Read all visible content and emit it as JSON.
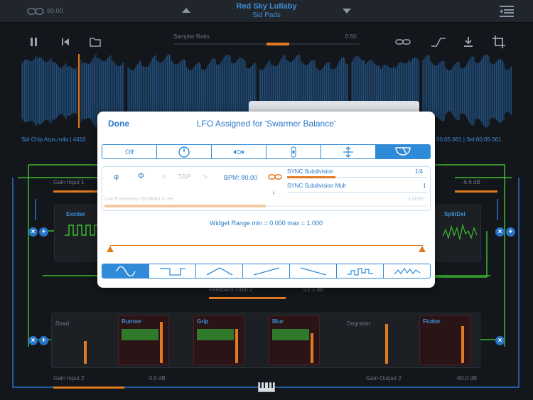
{
  "topbar": {
    "link_value": "60.00",
    "preset_name": "Red Sky Lullaby",
    "preset_bank": "Sid Pads"
  },
  "transport": {
    "sampler_label": "Sampler Ratio",
    "sampler_value": "0.50",
    "sampler_ratio": 0.5
  },
  "waveform": {
    "file_info": "Sid Chip Arps.m4a | 4410",
    "selection_info": "00:05.061 | Sel:00:05.061"
  },
  "rack": {
    "gain_input_1": "Gain Input 1",
    "gain_input_1_value": "-6.6 dB",
    "exciter": "Exciter",
    "splitdel": "SplitDel",
    "feedback_label": "Feedback Orbit 2",
    "feedback_value": "-12.1 dB",
    "dead_label": "Dead",
    "runner": "Runner",
    "grip": "Grip",
    "blur": "Blur",
    "degrader": "Degrader",
    "flutter": "Flutter",
    "gain_input_2": "Gain Input 2",
    "gain_input_2_value": "-3.0 dB",
    "gain_output_2": "Gain Output 2",
    "gain_output_2_value": "-60.0 dB"
  },
  "modal": {
    "done_label": "Done",
    "title": "LFO Assigned for 'Swarmer Balance'",
    "mode_segments": [
      {
        "label": "Off",
        "icon": "off",
        "active": false
      },
      {
        "label": "",
        "icon": "dial-icon",
        "active": false
      },
      {
        "label": "",
        "icon": "horizontal-move-icon",
        "active": false
      },
      {
        "label": "",
        "icon": "vertical-move-icon",
        "active": false
      },
      {
        "label": "",
        "icon": "arrows-vertical-icon",
        "active": false
      },
      {
        "label": "",
        "icon": "gauge-icon",
        "active": true
      }
    ],
    "lfo": {
      "phase_symbol": "φ",
      "invert_symbol": "Φ",
      "prev": "<",
      "tap": "TAP",
      "next": ">",
      "bpm": "BPM: 80.00",
      "sync_subdivision_label": "SYNC Subdivision",
      "sync_subdivision_value": "1/4",
      "sync_subdivision_mult_label": "SYNC Subdivision Mult",
      "sync_subdivision_mult_value": "1",
      "freq_label": "Low Frequency Oscillator in Hz",
      "freq_value": "1.0000",
      "freq_level": 0.5
    },
    "range_label": "Widget Range min = 0.000 max = 1.000",
    "shapes": [
      {
        "icon": "sine-wave-icon",
        "active": true
      },
      {
        "icon": "square-wave-icon",
        "active": false
      },
      {
        "icon": "triangle-wave-icon",
        "active": false
      },
      {
        "icon": "ramp-up-icon",
        "active": false
      },
      {
        "icon": "ramp-down-icon",
        "active": false
      },
      {
        "icon": "random-step-icon",
        "active": false
      },
      {
        "icon": "noise-wave-icon",
        "active": false
      }
    ]
  },
  "colors": {
    "accent_blue": "#2f8bd7",
    "accent_orange": "#e07a20",
    "signal_green": "#3dbb2c"
  }
}
